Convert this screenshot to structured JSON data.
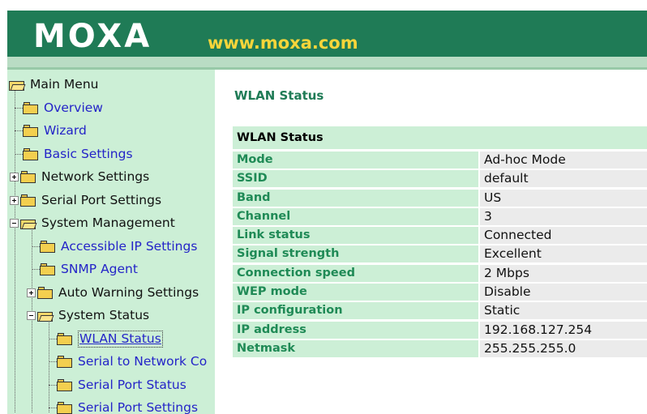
{
  "header": {
    "brand": "MOXA",
    "url": "www.moxa.com"
  },
  "sidebar": {
    "root": "Main Menu",
    "items": [
      {
        "label": "Overview"
      },
      {
        "label": "Wizard"
      },
      {
        "label": "Basic Settings"
      },
      {
        "label": "Network Settings"
      },
      {
        "label": "Serial Port Settings"
      },
      {
        "label": "System Management"
      },
      {
        "label": "Accessible IP Settings"
      },
      {
        "label": "SNMP Agent"
      },
      {
        "label": "Auto Warning Settings"
      },
      {
        "label": "System Status"
      },
      {
        "label": "WLAN Status"
      },
      {
        "label": "Serial to Network Co"
      },
      {
        "label": "Serial Port Status"
      },
      {
        "label": "Serial Port Settings"
      }
    ]
  },
  "main": {
    "title": "WLAN Status",
    "table_title": "WLAN Status",
    "rows": [
      {
        "label": "Mode",
        "value": "Ad-hoc Mode"
      },
      {
        "label": "SSID",
        "value": "default"
      },
      {
        "label": "Band",
        "value": "US"
      },
      {
        "label": "Channel",
        "value": "3"
      },
      {
        "label": "Link status",
        "value": "Connected"
      },
      {
        "label": "Signal strength",
        "value": "Excellent"
      },
      {
        "label": "Connection speed",
        "value": "2 Mbps"
      },
      {
        "label": "WEP mode",
        "value": "Disable"
      },
      {
        "label": "IP configuration",
        "value": "Static"
      },
      {
        "label": "IP address",
        "value": "192.168.127.254"
      },
      {
        "label": "Netmask",
        "value": "255.255.255.0"
      }
    ]
  },
  "colors": {
    "header_green": "#1f7b56",
    "logo_yellow": "#f7d53a",
    "panel_green": "#ccefd6",
    "label_green": "#1f8a56",
    "link_blue": "#2424c8"
  }
}
